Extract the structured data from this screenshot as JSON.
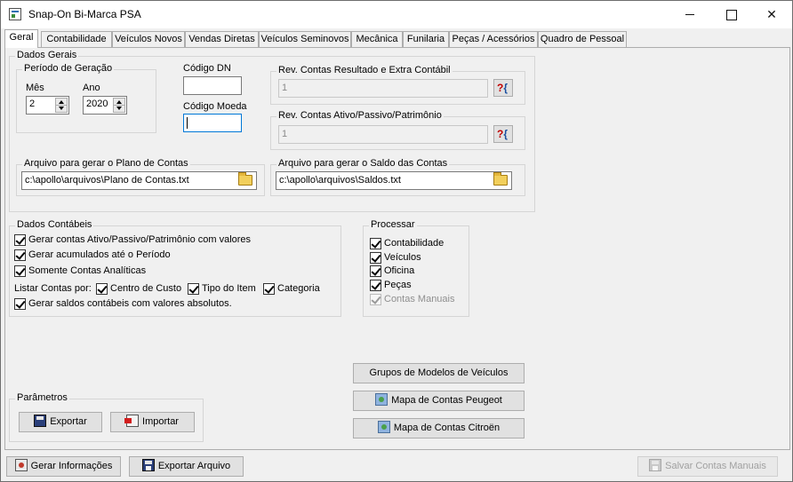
{
  "window": {
    "title": "Snap-On Bi-Marca PSA",
    "minimize_icon": "minimize-icon",
    "maximize_icon": "maximize-icon",
    "close_glyph": "✕"
  },
  "tabs": [
    {
      "label": "Geral",
      "active": true
    },
    {
      "label": "Contabilidade"
    },
    {
      "label": "Veículos Novos"
    },
    {
      "label": "Vendas Diretas"
    },
    {
      "label": "Veículos Seminovos"
    },
    {
      "label": "Mecânica"
    },
    {
      "label": "Funilaria"
    },
    {
      "label": "Peças / Acessórios"
    },
    {
      "label": "Quadro de Pessoal"
    }
  ],
  "dados_gerais": {
    "title": "Dados Gerais",
    "periodo": {
      "title": "Período de Geração",
      "mes_label": "Mês",
      "mes_value": "2",
      "ano_label": "Ano",
      "ano_value": "2020"
    },
    "codigo_dn_label": "Código DN",
    "codigo_dn_value": "",
    "codigo_moeda_label": "Código Moeda",
    "codigo_moeda_value": "",
    "rev_resultado": {
      "title": "Rev. Contas Resultado e Extra Contábil",
      "value": "1"
    },
    "rev_ativo": {
      "title": "Rev. Contas Ativo/Passivo/Patrimônio",
      "value": "1"
    },
    "plano_contas": {
      "title": "Arquivo para gerar o Plano de Contas",
      "value": "c:\\apollo\\arquivos\\Plano de Contas.txt"
    },
    "saldo_contas": {
      "title": "Arquivo para gerar o Saldo das Contas",
      "value": "c:\\apollo\\arquivos\\Saldos.txt"
    },
    "help_glyph": "?"
  },
  "dados_contabeis": {
    "title": "Dados Contábeis",
    "options": [
      "Gerar contas Ativo/Passivo/Patrimônio com valores",
      "Gerar acumulados até o Período",
      "Somente Contas Analíticas"
    ],
    "listar_label": "Listar Contas por:",
    "listar_options": [
      "Centro de Custo",
      "Tipo do Item",
      "Categoria"
    ],
    "absolutos": "Gerar saldos contábeis com valores absolutos."
  },
  "processar": {
    "title": "Processar",
    "items": [
      {
        "label": "Contabilidade",
        "enabled": true
      },
      {
        "label": "Veículos",
        "enabled": true
      },
      {
        "label": "Oficina",
        "enabled": true
      },
      {
        "label": "Peças",
        "enabled": true
      },
      {
        "label": "Contas Manuais",
        "enabled": false
      }
    ]
  },
  "right_buttons": {
    "grupos": "Grupos de Modelos de Veículos",
    "peugeot": "Mapa de Contas Peugeot",
    "citroen": "Mapa de Contas Citroën"
  },
  "parametros": {
    "title": "Parâmetros",
    "exportar": "Exportar",
    "importar": "Importar"
  },
  "bottom": {
    "gerar": "Gerar Informações",
    "exportar_arquivo": "Exportar Arquivo",
    "salvar_manuais": "Salvar Contas Manuais"
  }
}
